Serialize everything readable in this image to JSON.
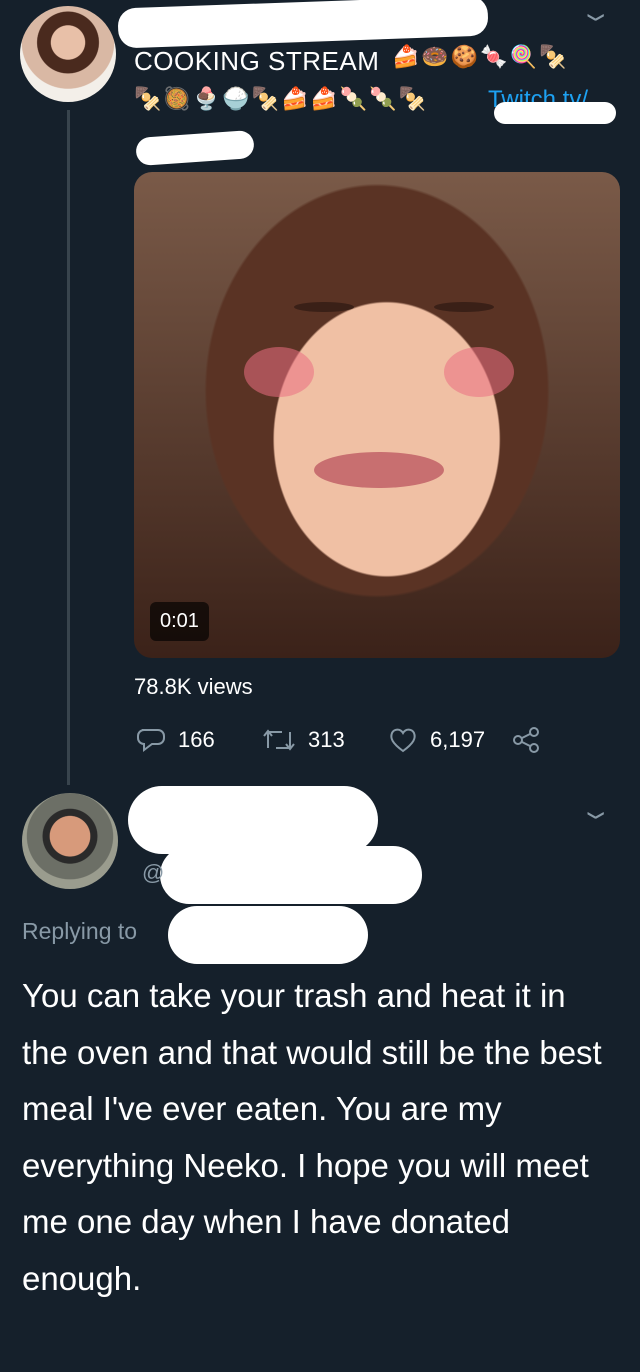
{
  "tweet": {
    "display_name": "COOKING STREAM",
    "emoji_line_1": "🍰🍩🍪🍬🍭🍢",
    "emoji_line_2": "🍢🥘🍨🍚🍢🍰🍰🍡🍡🍢",
    "link_text": "Twitch.tv/",
    "video": {
      "timestamp": "0:01"
    },
    "views": "78.8K views",
    "actions": {
      "replies": "166",
      "retweets": "313",
      "likes": "6,197"
    }
  },
  "reply": {
    "replying_to_label": "Replying to",
    "handle_prefix": "@",
    "text": "You can take your trash and heat it in the oven and that would still be the best meal I've ever eaten. You are my everything Neeko. I hope you will meet me one day when I have donated enough."
  },
  "colors": {
    "background": "#15202b",
    "muted": "#8899a6",
    "link": "#1da1f2",
    "thread": "#38444d"
  },
  "icons": [
    "chevron-down-icon",
    "reply-icon",
    "retweet-icon",
    "like-icon",
    "share-icon"
  ]
}
